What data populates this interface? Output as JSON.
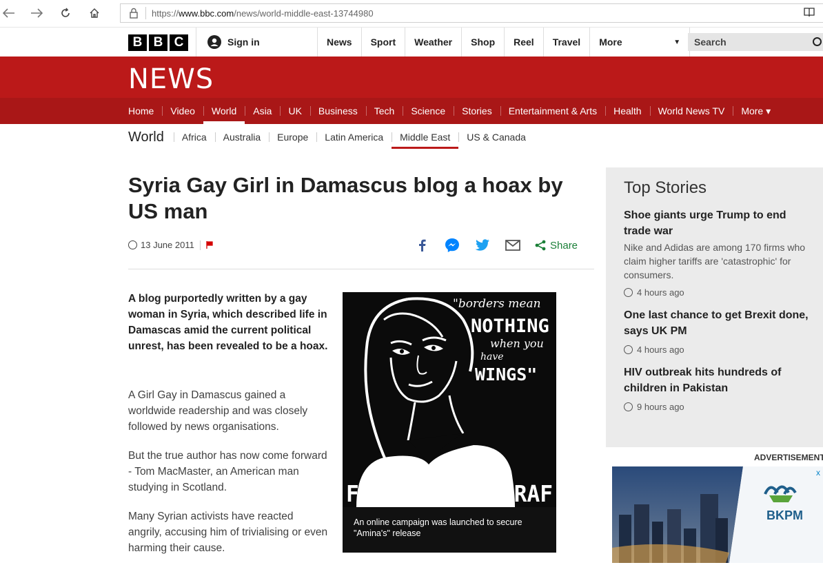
{
  "browser": {
    "url_prefix": "https://",
    "url_domain": "www.bbc.com",
    "url_path": "/news/world-middle-east-13744980"
  },
  "masthead": {
    "logo_letters": [
      "B",
      "B",
      "C"
    ],
    "signin_label": "Sign in",
    "nav": [
      "News",
      "Sport",
      "Weather",
      "Shop",
      "Reel",
      "Travel"
    ],
    "more_label": "More",
    "search_placeholder": "Search"
  },
  "news_banner": {
    "title": "NEWS",
    "nav": [
      {
        "label": "Home",
        "active": false
      },
      {
        "label": "Video",
        "active": false
      },
      {
        "label": "World",
        "active": true
      },
      {
        "label": "Asia",
        "active": false
      },
      {
        "label": "UK",
        "active": false
      },
      {
        "label": "Business",
        "active": false
      },
      {
        "label": "Tech",
        "active": false
      },
      {
        "label": "Science",
        "active": false
      },
      {
        "label": "Stories",
        "active": false
      },
      {
        "label": "Entertainment & Arts",
        "active": false
      },
      {
        "label": "Health",
        "active": false
      },
      {
        "label": "World News TV",
        "active": false
      },
      {
        "label": "More ▾",
        "active": false
      }
    ]
  },
  "subnav": {
    "section": "World",
    "items": [
      {
        "label": "Africa",
        "active": false
      },
      {
        "label": "Australia",
        "active": false
      },
      {
        "label": "Europe",
        "active": false
      },
      {
        "label": "Latin America",
        "active": false
      },
      {
        "label": "Middle East",
        "active": true
      },
      {
        "label": "US & Canada",
        "active": false
      }
    ]
  },
  "article": {
    "headline": "Syria Gay Girl in Damascus blog a hoax by US man",
    "date": "13 June 2011",
    "share_label": "Share",
    "intro": "A blog purportedly written by a gay woman in Syria, which described life in Damascas amid the current political unrest, has been revealed to be a hoax.",
    "paragraphs": [
      "A Girl Gay in Damascus gained a worldwide readership and was closely followed by news organisations.",
      "But the true author has now come forward - Tom MacMaster, an American man studying in Scotland.",
      "Many Syrian activists have reacted angrily, accusing him of trivialising or even harming their cause."
    ],
    "image": {
      "quote_line1": "\"borders mean",
      "quote_line2": "NOTHING",
      "quote_line3": "when you",
      "quote_line4": "have",
      "quote_line5": "WINGS\"",
      "banner": "FREE AMINA ARRAF",
      "caption": "An online campaign was launched to secure \"Amina's\" release"
    }
  },
  "top_stories": {
    "title": "Top Stories",
    "stories": [
      {
        "headline": "Shoe giants urge Trump to end trade war",
        "summary": "Nike and Adidas are among 170 firms who claim higher tariffs are 'catastrophic' for consumers.",
        "time": "4 hours ago"
      },
      {
        "headline": "One last chance to get Brexit done, says UK PM",
        "summary": "",
        "time": "4 hours ago"
      },
      {
        "headline": "HIV outbreak hits hundreds of children in Pakistan",
        "summary": "",
        "time": "9 hours ago"
      }
    ]
  },
  "advertisement": {
    "label": "ADVERTISEMENT",
    "brand": "BKPM",
    "close": "x"
  },
  "colors": {
    "bbc_red": "#bb1919",
    "nav_red": "#a91717",
    "share_green": "#1a7f37",
    "facebook": "#3b5998",
    "messenger": "#0084ff",
    "twitter": "#1da1f2"
  }
}
